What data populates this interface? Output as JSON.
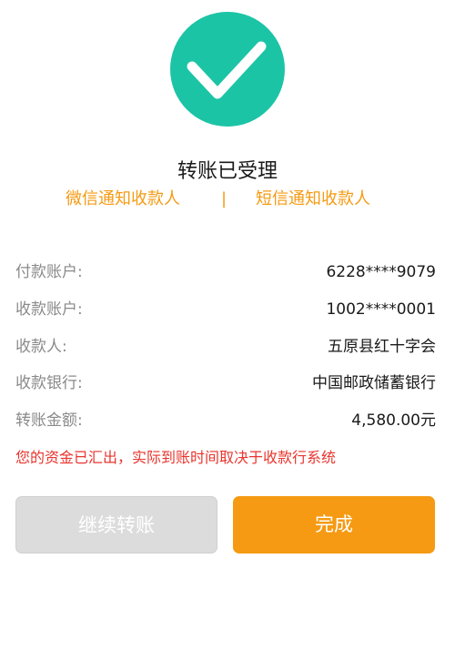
{
  "status": {
    "icon": "checkmark-icon",
    "title": "转账已受理",
    "color": "#1cc4a6"
  },
  "notify": {
    "wechat_label": "微信通知收款人",
    "separator": "|",
    "sms_label": "短信通知收款人",
    "color": "#f59a12"
  },
  "details": {
    "payer_account": {
      "label": "付款账户:",
      "value": "6228****9079"
    },
    "payee_account": {
      "label": "收款账户:",
      "value": "1002****0001"
    },
    "payee_name": {
      "label": "收款人:",
      "value": "五原县红十字会"
    },
    "payee_bank": {
      "label": "收款银行:",
      "value": "中国邮政储蓄银行"
    },
    "amount": {
      "label": "转账金额:",
      "value": "4,580.00元"
    }
  },
  "notice": {
    "text": "您的资金已汇出，实际到账时间取决于收款行系统",
    "color": "#e8352e"
  },
  "actions": {
    "continue_label": "继续转账",
    "done_label": "完成",
    "done_color": "#f59a12"
  }
}
